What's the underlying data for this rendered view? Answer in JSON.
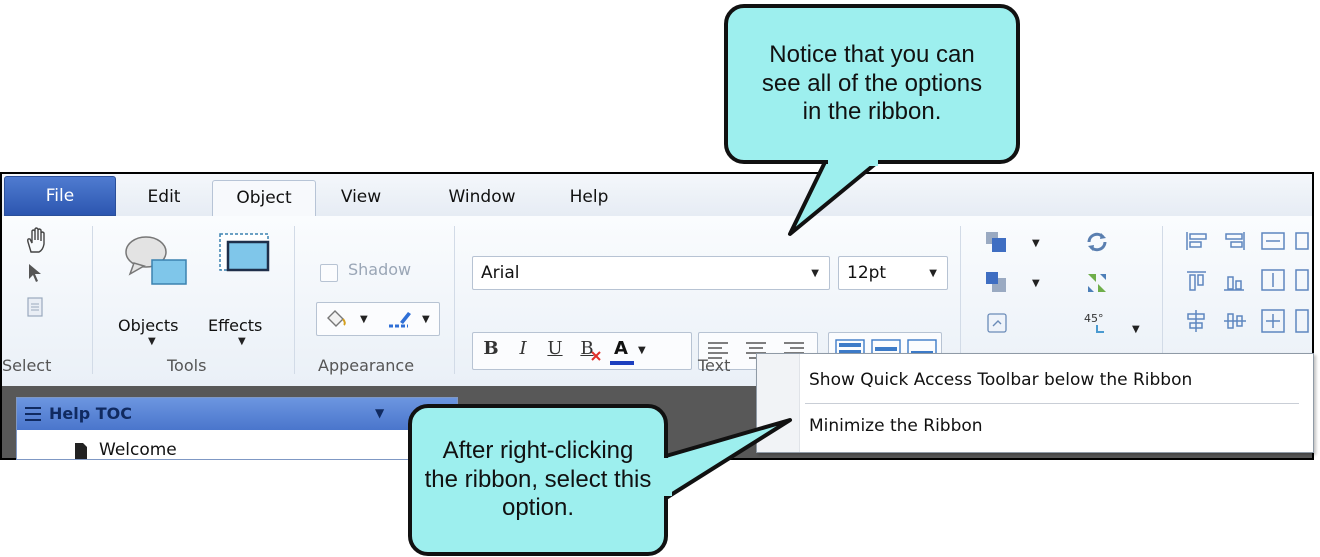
{
  "tabs": {
    "file": "File",
    "edit": "Edit",
    "object": "Object",
    "view": "View",
    "window": "Window",
    "help": "Help"
  },
  "ribbon": {
    "groups": {
      "select": "Select",
      "tools": "Tools",
      "appearance": "Appearance",
      "text": "Text"
    },
    "tools": {
      "objects": "Objects",
      "effects": "Effects"
    },
    "appearance": {
      "shadow": "Shadow"
    },
    "text": {
      "font": "Arial",
      "size": "12pt",
      "bold": "B",
      "italic": "I",
      "underline": "U",
      "clear": "B",
      "color": "A"
    },
    "rotate_label": "45°"
  },
  "panel": {
    "title": "Help TOC",
    "item": "Welcome"
  },
  "context_menu": {
    "item1": "Show Quick Access Toolbar below the Ribbon",
    "item2": "Minimize the Ribbon"
  },
  "callouts": {
    "top": "Notice that you can see all of the options in the ribbon.",
    "bottom": "After right-clicking the ribbon, select this option."
  },
  "colors": {
    "callout_fill": "#9defee",
    "file_tab": "#2c56b0",
    "panel_header": "#4a76cc"
  }
}
